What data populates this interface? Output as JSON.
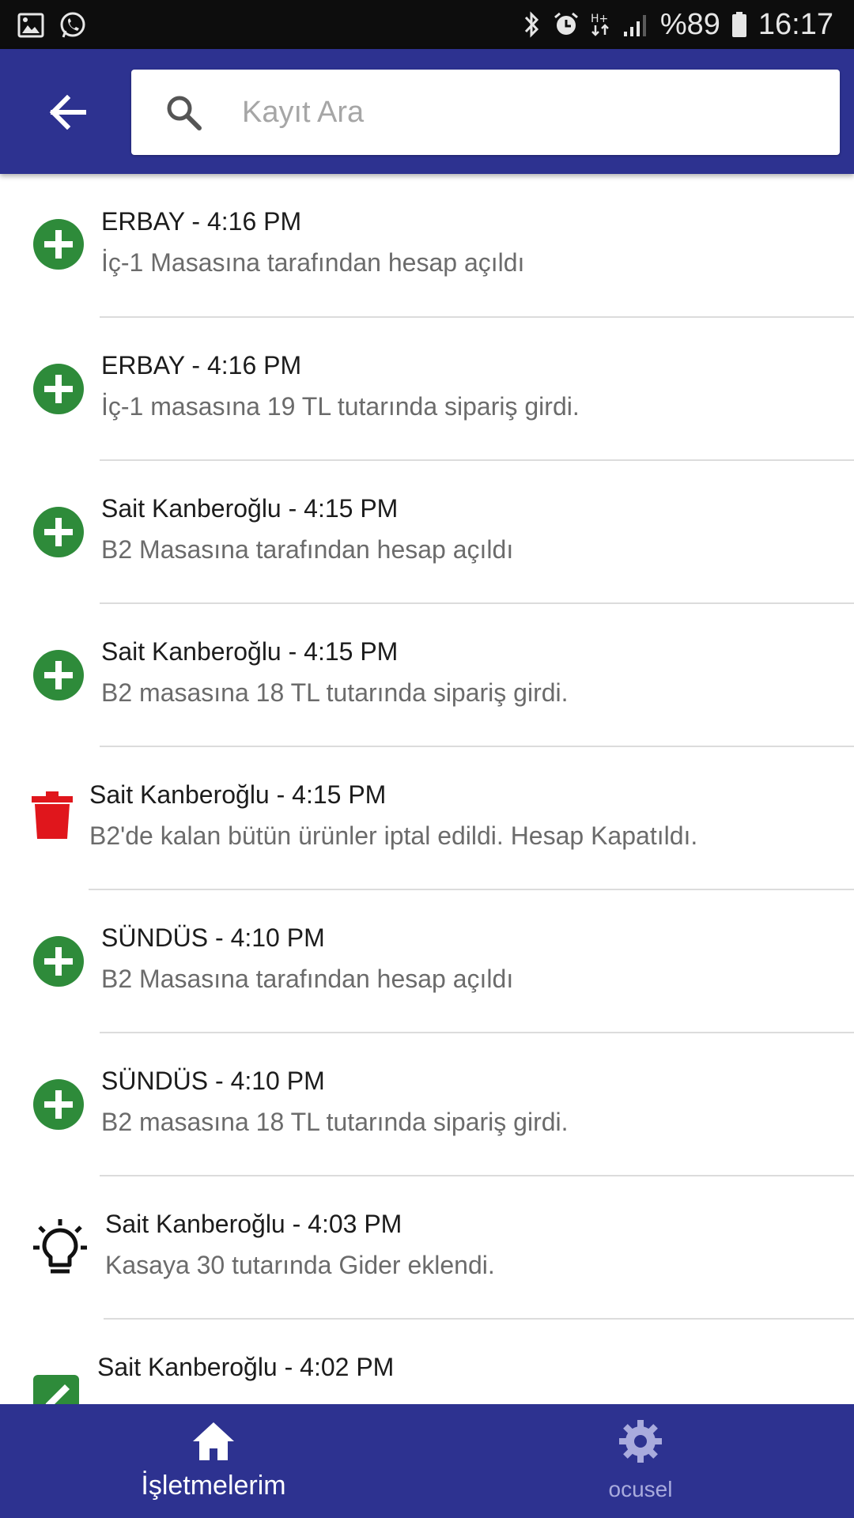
{
  "status_bar": {
    "battery_percent": "%89",
    "time": "16:17",
    "colors": {
      "background": "#0d0d0d",
      "foreground": "#e6e6e6"
    }
  },
  "app_bar": {
    "back_icon": "arrow-back-icon",
    "search": {
      "placeholder": "Kayıt Ara",
      "value": "",
      "icon": "search-icon"
    },
    "colors": {
      "background": "#2d3290"
    }
  },
  "feed": {
    "items": [
      {
        "type": "add",
        "icon": "add-circle-icon",
        "title": "ERBAY - 4:16 PM",
        "detail": "İç-1 Masasına tarafından hesap açıldı"
      },
      {
        "type": "add",
        "icon": "add-circle-icon",
        "title": "ERBAY - 4:16 PM",
        "detail": "İç-1 masasına 19 TL tutarında sipariş girdi."
      },
      {
        "type": "add",
        "icon": "add-circle-icon",
        "title": "Sait Kanberoğlu - 4:15 PM",
        "detail": "B2 Masasına tarafından hesap açıldı"
      },
      {
        "type": "add",
        "icon": "add-circle-icon",
        "title": "Sait Kanberoğlu - 4:15 PM",
        "detail": "B2 masasına 18 TL tutarında sipariş girdi."
      },
      {
        "type": "delete",
        "icon": "trash-icon",
        "title": "Sait Kanberoğlu - 4:15 PM",
        "detail": "B2'de kalan bütün ürünler iptal edildi. Hesap Kapatıldı."
      },
      {
        "type": "add",
        "icon": "add-circle-icon",
        "title": "SÜNDÜS - 4:10 PM",
        "detail": "B2 Masasına tarafından hesap açıldı"
      },
      {
        "type": "add",
        "icon": "add-circle-icon",
        "title": "SÜNDÜS - 4:10 PM",
        "detail": "B2 masasına 18 TL tutarında sipariş girdi."
      },
      {
        "type": "expense",
        "icon": "lightbulb-icon",
        "title": "Sait Kanberoğlu - 4:03 PM",
        "detail": "Kasaya 30 tutarında Gider eklendi."
      },
      {
        "type": "edit",
        "icon": "edit-icon",
        "title": "Sait Kanberoğlu - 4:02 PM",
        "detail": ""
      }
    ],
    "colors": {
      "add": "#2e8b3a",
      "delete": "#e0161c",
      "title": "#1c1c1c",
      "detail": "#6b6b6b",
      "divider": "#dcdcdc"
    }
  },
  "bottom_nav": {
    "tabs": [
      {
        "label": "İşletmelerim",
        "icon": "home-icon",
        "active": true
      },
      {
        "label": "ocusel",
        "icon": "settings-gear-icon",
        "active": false
      }
    ],
    "colors": {
      "background": "#2d3290",
      "active": "#ffffff",
      "inactive": "#a9abdd"
    }
  }
}
